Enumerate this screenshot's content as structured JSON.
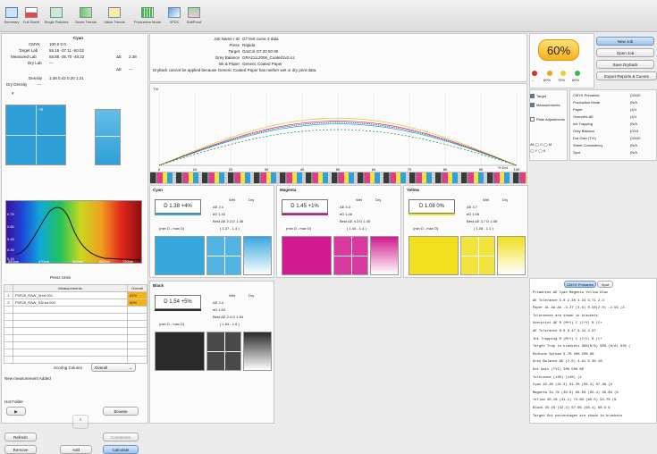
{
  "toolbar": {
    "items": [
      {
        "label": "Summary",
        "icon": "summary-icon",
        "active": true
      },
      {
        "label": "Full Sheet",
        "icon": "full-sheet-icon"
      },
      {
        "label": "Single Patches",
        "icon": "single-patches-icon"
      },
      {
        "label": "Score Trends",
        "icon": "score-trends-icon"
      },
      {
        "label": "Value Trends",
        "icon": "value-trends-icon"
      },
      {
        "label": "Production Mode",
        "icon": "production-mode-icon"
      },
      {
        "label": "XPDC",
        "icon": "xpdc-icon"
      },
      {
        "label": "SoftProof",
        "icon": "softproof-icon"
      }
    ]
  },
  "left": {
    "ink_name": "Cyan",
    "cmyk_label": "CMYK",
    "cmyk_values": "100     0     0     0",
    "target_lab_label": "Target Lab",
    "target_lab": "55.18   -37.11  -50.02",
    "measured_lab_label": "Measured Lab",
    "measured_lab": "55.85  -35.70  -48.22",
    "de_label": "ΔE",
    "de_value": "2.38",
    "dry_lab_label": "Dry Lab",
    "dry_lab": "---",
    "de2_label": "ΔE",
    "de2_value": "---",
    "density_label": "Density",
    "density_value": "1.38 0.42 0.20 1.21",
    "dry_density_label": "Dry Density",
    "dry_density_value": "---",
    "spectrum_yticks": [
      "0.75",
      "0.60",
      "0.45",
      "0.30",
      "0.15"
    ],
    "spectrum_xticks": [
      "380nm",
      "470nm",
      "560nm",
      "650nm",
      "730nm"
    ],
    "press_units_label": "Press Units",
    "table_header": [
      "Measurements",
      "Overall"
    ],
    "table_rows": [
      {
        "num": "1",
        "name": "P2P25_RAW_3t.txt 001",
        "overall": "61%"
      },
      {
        "num": "2",
        "name": "P2P25_RAW_S3t.txt 002",
        "overall": "60%"
      }
    ],
    "scoring_label": "Scoring Column",
    "scoring_value": "Overall",
    "new_measurement": "New measurement Added",
    "hot_folder_label": "Hot Folder",
    "browse": "Browse",
    "refresh": "Refresh",
    "comments": "Comments",
    "remove": "Remove",
    "add": "Add",
    "calculate": "Calculate",
    "play": "▶"
  },
  "job": {
    "lines": [
      {
        "k": "Job Name / ID",
        "v": "G7 test curve 3 data"
      },
      {
        "k": "Press",
        "v": "Rapida"
      },
      {
        "k": "Target",
        "v": "GraCol G7 20 50 80"
      },
      {
        "k": "Grey Balance",
        "v": "GRACoL2006_Coated1v2.icc"
      },
      {
        "k": "Ink & Paper",
        "v": "Generic Coated Paper"
      }
    ],
    "warning": "Dryback cannot be applied because Generic Coated Paper has neither wet or dry print data."
  },
  "score": {
    "value": "60%",
    "levels": [
      "60%",
      "70%",
      "80%"
    ]
  },
  "actions": {
    "new_job": "New Job",
    "open_job": "Open Job",
    "save_dryback": "Save Dryback",
    "export": "Export Reports & Curves"
  },
  "options": {
    "target": "Target",
    "measurements": "Measurements",
    "plate_adjustments": "Plate Adjustments",
    "channels": [
      "All",
      "C",
      "M",
      "Y",
      "K"
    ]
  },
  "summary_list": [
    {
      "k": "CMYK Primaries",
      "v": "(20/20"
    },
    {
      "k": "Production Mode",
      "v": "(N/A"
    },
    {
      "k": "Paper",
      "v": "(4/4"
    },
    {
      "k": "Overprint ΔE",
      "v": "(4/4"
    },
    {
      "k": "Ink Trapping",
      "v": "(N/A"
    },
    {
      "k": "Grey Balance",
      "v": "(0/15"
    },
    {
      "k": "Dot Gain (TVI)",
      "v": "(20/20"
    },
    {
      "k": "Sheet Consistency",
      "v": "(N/A"
    },
    {
      "k": "Spot",
      "v": "(N/A"
    }
  ],
  "curve": {
    "ylabel": "TVI",
    "xticks": [
      "0",
      "10",
      "20",
      "30",
      "40",
      "50",
      "60",
      "70",
      "80",
      "90",
      "100"
    ],
    "xlabel": "% Dot",
    "colors": {
      "cyan": "#1aa7d9",
      "magenta": "#d6238a",
      "yellow": "#d8c81b",
      "black": "#222222",
      "target": "#1a8a2a"
    }
  },
  "inks": [
    {
      "name": "Cyan",
      "dens": "D 1.38 +4%",
      "wet": "Wet",
      "dry": "Dry",
      "de": "ΔE 2.4",
      "ed": "eD 1.43",
      "best": "Best ΔE 2.3 D 1.38",
      "range_label": "(min D - max D)",
      "range": "( 1.37 - 1.4 )",
      "color": "#35a8de"
    },
    {
      "name": "Magenta",
      "dens": "D 1.45 +1%",
      "wet": "Wet",
      "dry": "Dry",
      "de": "ΔE 4.3",
      "ed": "eD 1.46",
      "best": "Best ΔE 4.3 D 1.45",
      "range_label": "(min D - max D)",
      "range": "( 1.44 - 1.4 )",
      "color": "#d2198f"
    },
    {
      "name": "Yellow",
      "dens": "D 1.08 0%",
      "wet": "Wet",
      "dry": "Dry",
      "de": "ΔE 3.7",
      "ed": "eD 1.08",
      "best": "Best ΔE 3.7 D 1.08",
      "range_label": "(min D - max D)",
      "range": "( 1.08 - 1.1 )",
      "color": "#f0e01f"
    },
    {
      "name": "Black",
      "dens": "D 1.54 +5%",
      "wet": "Wet",
      "dry": "Dry",
      "de": "ΔE 2.4",
      "ed": "eD 1.63",
      "best": "Best ΔE 2.4 D 1.54",
      "range_label": "(min D - max D)",
      "range": "( 1.54 - 1.5 )",
      "color": "#2a2a2a"
    }
  ],
  "report": {
    "tabs": [
      "CMYK Primaries",
      "Spot"
    ],
    "rows": [
      "Primaries ΔE          Cyan   Magenta  Yellow   Blac",
      "ΔE Tolerance   5.0    2.38    4.34    3.71    2.3",
      "Paper ΔL Δa Δb  -3.27  (3.0)   0.58(2.0)  -2.56  (2.",
      "Tolerances are shown in brackets",
      "Overprint ΔE        R (M+Y)    C (C+Y)    B (C+",
      "ΔE Tolerance  6.0     6.47       9.44      2.97",
      "Ink Trapping        R (M+Y)    C (C+Y)    B (C+",
      "Target Trap in brackets   88%(N/A)  95% (N/A)  91% (",
      "Midtone Spread     9.7%   20%       50%       80",
      "Grey Balance ΔE     (2.0)  4.81      5.30      10.",
      "Dot Gain (TVI)     20%       50%        80",
      "Tolerance          (±3%)     (±4%)      (±",
      "Cyan          32.2% (31.3)  61.2% (66.3)  87.3% (9",
      "Magenta       34.7% (30.9)  66.6% (65.4)  89.8% (9",
      "Yellow        40.1% (31.1)  74.9% (66.5)  94.7% (9",
      "Black         35.1% (32.4)  67.6% (68.4)  88.9    9",
      "Target Dot percentages are shown in brackets"
    ]
  }
}
